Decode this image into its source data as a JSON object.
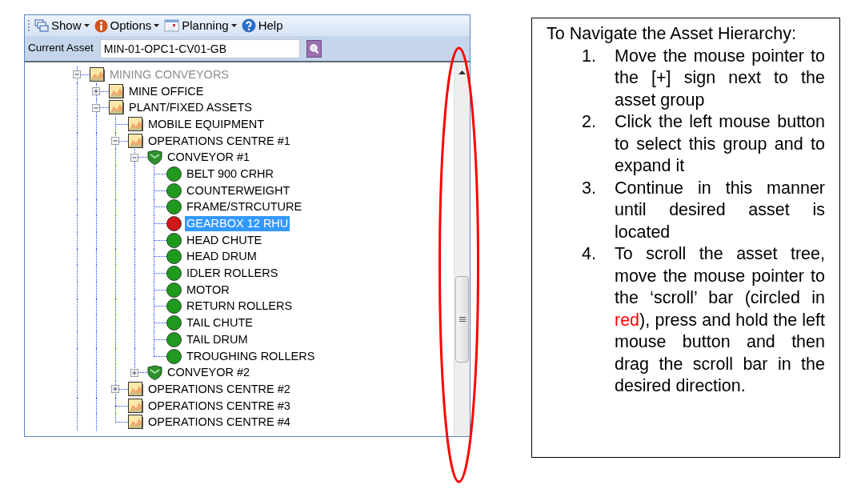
{
  "toolbar": [
    {
      "label": "Show",
      "kind": "windows",
      "dropdown": true
    },
    {
      "label": "Options",
      "kind": "info",
      "dropdown": true
    },
    {
      "label": "Planning",
      "kind": "calendar",
      "dropdown": true
    },
    {
      "label": "Help",
      "kind": "help",
      "dropdown": false
    }
  ],
  "current_asset": {
    "label": "Current Asset",
    "value": "MIN-01-OPC1-CV01-GB"
  },
  "tree": [
    {
      "label": "MINING CONVEYORS",
      "kind": "folder",
      "greyed": true,
      "selected": false,
      "expanded": true,
      "children": [
        {
          "label": "MINE OFFICE",
          "kind": "folder",
          "greyed": false,
          "selected": false,
          "expanded": false
        },
        {
          "label": "PLANT/FIXED ASSETS",
          "kind": "folder",
          "greyed": false,
          "selected": false,
          "expanded": true,
          "children": [
            {
              "label": "MOBILE EQUIPMENT",
              "kind": "folder",
              "greyed": false,
              "selected": false
            },
            {
              "label": "OPERATIONS CENTRE #1",
              "kind": "folder",
              "greyed": false,
              "selected": false,
              "expanded": true,
              "children": [
                {
                  "label": "CONVEYOR #1",
                  "kind": "conveyor",
                  "greyed": false,
                  "selected": false,
                  "expanded": true,
                  "children": [
                    {
                      "label": "BELT 900 CRHR",
                      "kind": "asset",
                      "color": "#1f9a1f",
                      "greyed": false,
                      "selected": false
                    },
                    {
                      "label": "COUNTERWEIGHT",
                      "kind": "asset",
                      "color": "#1f9a1f",
                      "greyed": false,
                      "selected": false
                    },
                    {
                      "label": "FRAME/STRCUTURE",
                      "kind": "asset",
                      "color": "#1f9a1f",
                      "greyed": false,
                      "selected": false
                    },
                    {
                      "label": "GEARBOX 12 RHU",
                      "kind": "asset",
                      "color": "#d01818",
                      "greyed": false,
                      "selected": true
                    },
                    {
                      "label": "HEAD CHUTE",
                      "kind": "asset",
                      "color": "#1f9a1f",
                      "greyed": false,
                      "selected": false
                    },
                    {
                      "label": "HEAD DRUM",
                      "kind": "asset",
                      "color": "#1f9a1f",
                      "greyed": false,
                      "selected": false
                    },
                    {
                      "label": "IDLER ROLLERS",
                      "kind": "asset",
                      "color": "#1f9a1f",
                      "greyed": false,
                      "selected": false
                    },
                    {
                      "label": "MOTOR",
                      "kind": "asset",
                      "color": "#1f9a1f",
                      "greyed": false,
                      "selected": false
                    },
                    {
                      "label": "RETURN ROLLERS",
                      "kind": "asset",
                      "color": "#1f9a1f",
                      "greyed": false,
                      "selected": false
                    },
                    {
                      "label": "TAIL CHUTE",
                      "kind": "asset",
                      "color": "#1f9a1f",
                      "greyed": false,
                      "selected": false
                    },
                    {
                      "label": "TAIL DRUM",
                      "kind": "asset",
                      "color": "#1f9a1f",
                      "greyed": false,
                      "selected": false
                    },
                    {
                      "label": "TROUGHING ROLLERS",
                      "kind": "asset",
                      "color": "#1f9a1f",
                      "greyed": false,
                      "selected": false
                    }
                  ]
                },
                {
                  "label": "CONVEYOR #2",
                  "kind": "conveyor",
                  "greyed": false,
                  "selected": false,
                  "expanded": false
                }
              ]
            },
            {
              "label": "OPERATIONS CENTRE #2",
              "kind": "folder",
              "greyed": false,
              "selected": false,
              "expanded": false
            },
            {
              "label": "OPERATIONS CENTRE #3",
              "kind": "folder",
              "greyed": false,
              "selected": false
            },
            {
              "label": "OPERATIONS CENTRE #4",
              "kind": "folder",
              "greyed": false,
              "selected": false
            }
          ]
        }
      ]
    }
  ],
  "instructions": {
    "heading": "To Navigate the Asset Hierarchy:",
    "steps": [
      {
        "number": "1.",
        "parts": [
          {
            "text": "Move the mouse pointer to the [+] sign next to the asset group"
          }
        ]
      },
      {
        "number": "2.",
        "parts": [
          {
            "text": "Click the left mouse button to select this group and to expand it"
          }
        ]
      },
      {
        "number": "3.",
        "parts": [
          {
            "text": "Continue in this manner until desired asset is located"
          }
        ]
      },
      {
        "number": "4.",
        "parts": [
          {
            "text": "To scroll the asset tree, move the mouse pointer to the ‘scroll’ bar (circled in "
          },
          {
            "text": "red",
            "color": "#ff0000"
          },
          {
            "text": "), press and hold the left mouse button and then drag the scroll bar in the desired direction."
          }
        ]
      }
    ]
  }
}
